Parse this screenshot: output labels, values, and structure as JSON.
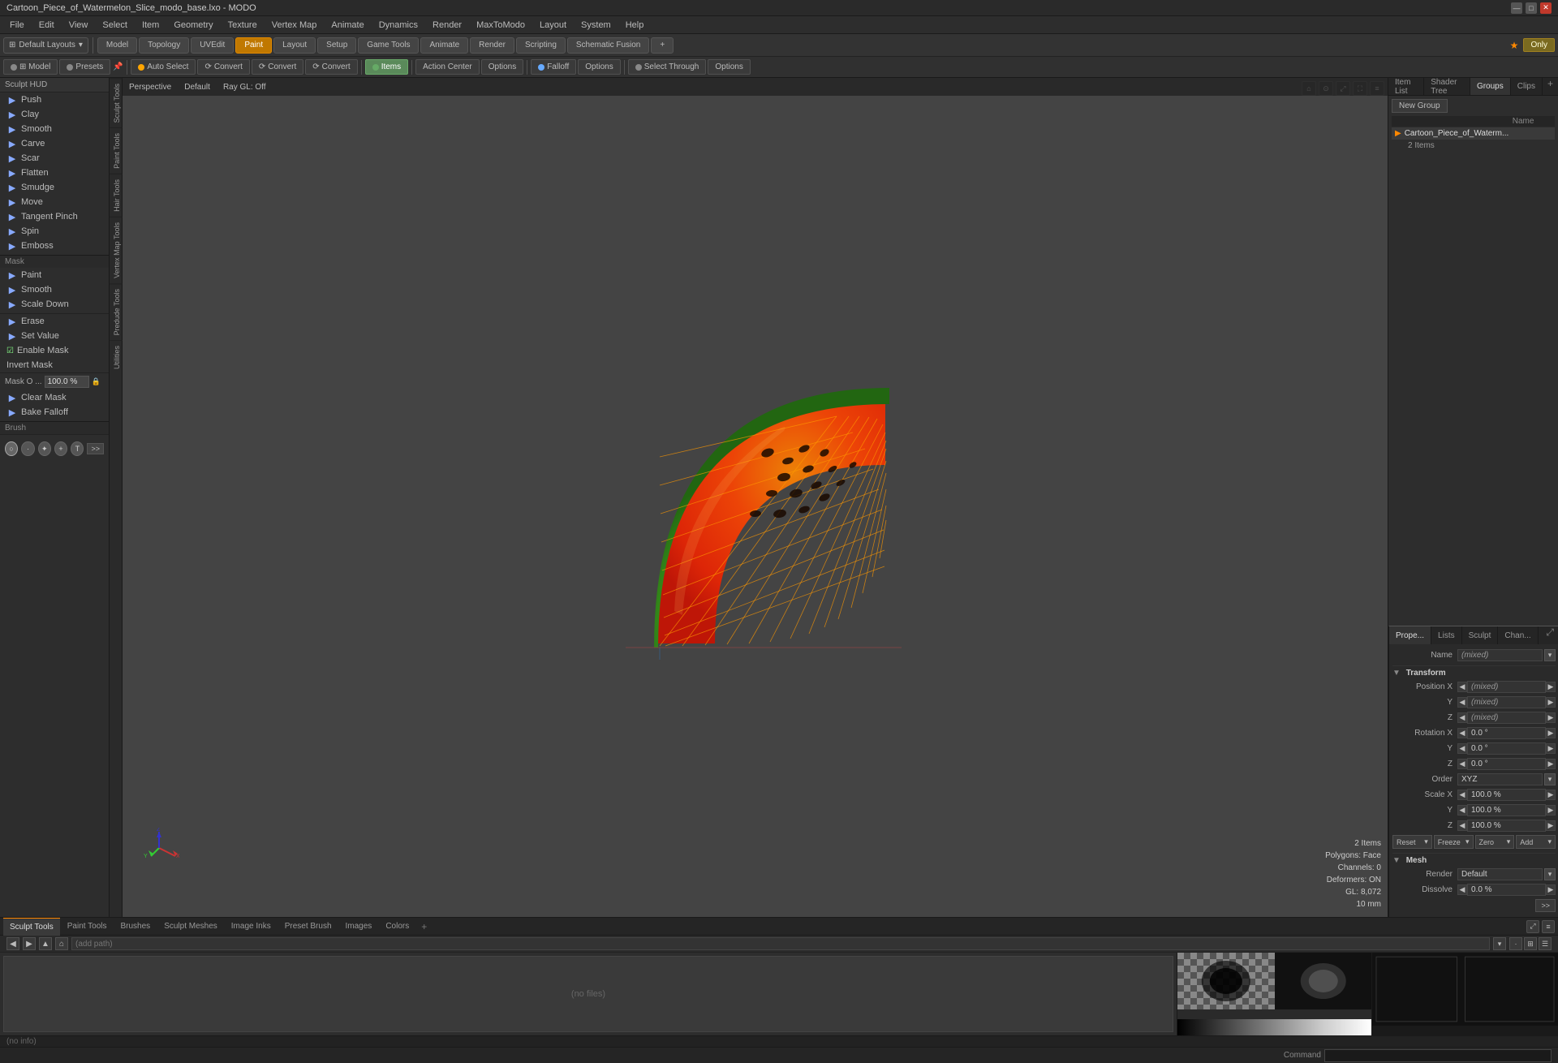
{
  "app": {
    "title": "Cartoon_Piece_of_Watermelon_Slice_modo_base.lxo - MODO",
    "min": "—",
    "max": "□",
    "close": "✕"
  },
  "menubar": {
    "items": [
      "File",
      "Edit",
      "View",
      "Select",
      "Item",
      "Geometry",
      "Texture",
      "Vertex Map",
      "Animate",
      "Dynamics",
      "Render",
      "MaxToModo",
      "Layout",
      "System",
      "Help"
    ]
  },
  "toolbar1": {
    "presets_label": "Default Layouts",
    "star_label": "★",
    "only_label": "Only"
  },
  "modetabs": {
    "tabs": [
      "Model",
      "Topology",
      "UVEdit",
      "Paint",
      "Layout",
      "Setup",
      "Game Tools",
      "Animate",
      "Render",
      "Scripting",
      "Schematic Fusion"
    ],
    "active": "Paint",
    "add": "+"
  },
  "toolbar2": {
    "buttons": [
      {
        "label": "Auto Select",
        "icon": "◉",
        "active": false
      },
      {
        "label": "Convert",
        "icon": "⟳",
        "active": false
      },
      {
        "label": "Convert",
        "icon": "⟳",
        "active": false
      },
      {
        "label": "Convert",
        "icon": "⟳",
        "active": false
      },
      {
        "label": "Items",
        "icon": "◆",
        "active": true
      },
      {
        "label": "Action Center",
        "active": false
      },
      {
        "label": "Options",
        "active": false
      },
      {
        "label": "Falloff",
        "active": false
      },
      {
        "label": "Options",
        "active": false
      },
      {
        "label": "Select Through",
        "active": false
      },
      {
        "label": "Options",
        "active": false
      }
    ]
  },
  "left_sidebar": {
    "hud_label": "Sculpt HUD",
    "tools": [
      {
        "name": "Push",
        "icon": "⬤"
      },
      {
        "name": "Clay",
        "icon": "⬤"
      },
      {
        "name": "Smooth",
        "icon": "⬤"
      },
      {
        "name": "Carve",
        "icon": "⬤"
      },
      {
        "name": "Scar",
        "icon": "⬤"
      },
      {
        "name": "Flatten",
        "icon": "⬤"
      },
      {
        "name": "Smudge",
        "icon": "⬤"
      },
      {
        "name": "Move",
        "icon": "⬤"
      },
      {
        "name": "Tangent Pinch",
        "icon": "⬤"
      },
      {
        "name": "Spin",
        "icon": "⬤"
      },
      {
        "name": "Emboss",
        "icon": "⬤"
      }
    ],
    "mask_section": "Mask",
    "mask_tools": [
      {
        "name": "Paint",
        "icon": "⬤"
      },
      {
        "name": "Smooth",
        "icon": "⬤"
      },
      {
        "name": "Scale Down",
        "icon": "⬤"
      }
    ],
    "erase_tools": [
      {
        "name": "Erase",
        "icon": "⬤"
      },
      {
        "name": "Set Value",
        "icon": "⬤"
      }
    ],
    "enable_mask_label": "Enable Mask",
    "invert_mask_label": "Invert Mask",
    "mask_opacity_label": "Mask O ...",
    "mask_opacity_value": "100.0 %",
    "clear_mask_label": "Clear Mask",
    "bake_falloff_label": "Bake Falloff",
    "brush_section": "Brush"
  },
  "side_tabs": [
    "Sculpt Tools",
    "Paint Tools",
    "Hair Tools",
    "Vertex Map Tools",
    "Predude Tools",
    "Utilities"
  ],
  "viewport": {
    "label_perspective": "Perspective",
    "label_default": "Default",
    "raygl": "Ray GL: Off",
    "info_items": "2 Items",
    "info_polygons": "Polygons: Face",
    "info_channels": "Channels: 0",
    "info_deformers": "Deformers: ON",
    "info_gl": "GL: 8,072",
    "info_distance": "10 mm"
  },
  "right_panel": {
    "tabs": [
      "Item List",
      "Shader Tree",
      "Groups",
      "Clips"
    ],
    "active_tab": "Groups",
    "add_btn": "+",
    "new_group_btn": "New Group",
    "table_cols": [
      "",
      "",
      "",
      "Name"
    ],
    "group_item_icon": "▶",
    "group_item_name": "Cartoon_Piece_of_Waterm...",
    "group_item_count": "2 Items"
  },
  "props_panel": {
    "tabs": [
      "Prope...",
      "Lists",
      "Sculpt",
      "Chan..."
    ],
    "active_tab": "Prope...",
    "expand_btn": "⤢",
    "name_label": "Name",
    "name_value": "(mixed)",
    "transform_section": "Transform",
    "pos_x_label": "Position X",
    "pos_x_value": "(mixed)",
    "pos_y_label": "Y",
    "pos_y_value": "(mixed)",
    "pos_z_label": "Z",
    "pos_z_value": "(mixed)",
    "rot_x_label": "Rotation X",
    "rot_x_value": "0.0 °",
    "rot_y_label": "Y",
    "rot_y_value": "0.0 °",
    "rot_z_label": "Z",
    "rot_z_value": "0.0 °",
    "order_label": "Order",
    "order_value": "XYZ",
    "scale_x_label": "Scale X",
    "scale_x_value": "100.0 %",
    "scale_y_label": "Y",
    "scale_y_value": "100.0 %",
    "scale_z_label": "Z",
    "scale_z_value": "100.0 %",
    "reset_btn": "Reset",
    "freeze_btn": "Freeze",
    "zero_btn": "Zero",
    "add_btn": "Add",
    "mesh_section": "Mesh",
    "render_label": "Render",
    "render_value": "Default",
    "dissolve_label": "Dissolve",
    "dissolve_value": "0.0 %"
  },
  "bottom_panel": {
    "tabs": [
      "Sculpt Tools",
      "Paint Tools",
      "Brushes",
      "Sculpt Meshes",
      "Image Inks",
      "Preset Brush",
      "Images",
      "Colors"
    ],
    "active_tab": "Sculpt Tools",
    "add_btn": "+",
    "path_placeholder": "(add path)",
    "no_files": "(no files)",
    "status_info": "(no info)"
  },
  "statusbar": {
    "info": "",
    "command_label": "Command",
    "command_placeholder": ""
  }
}
